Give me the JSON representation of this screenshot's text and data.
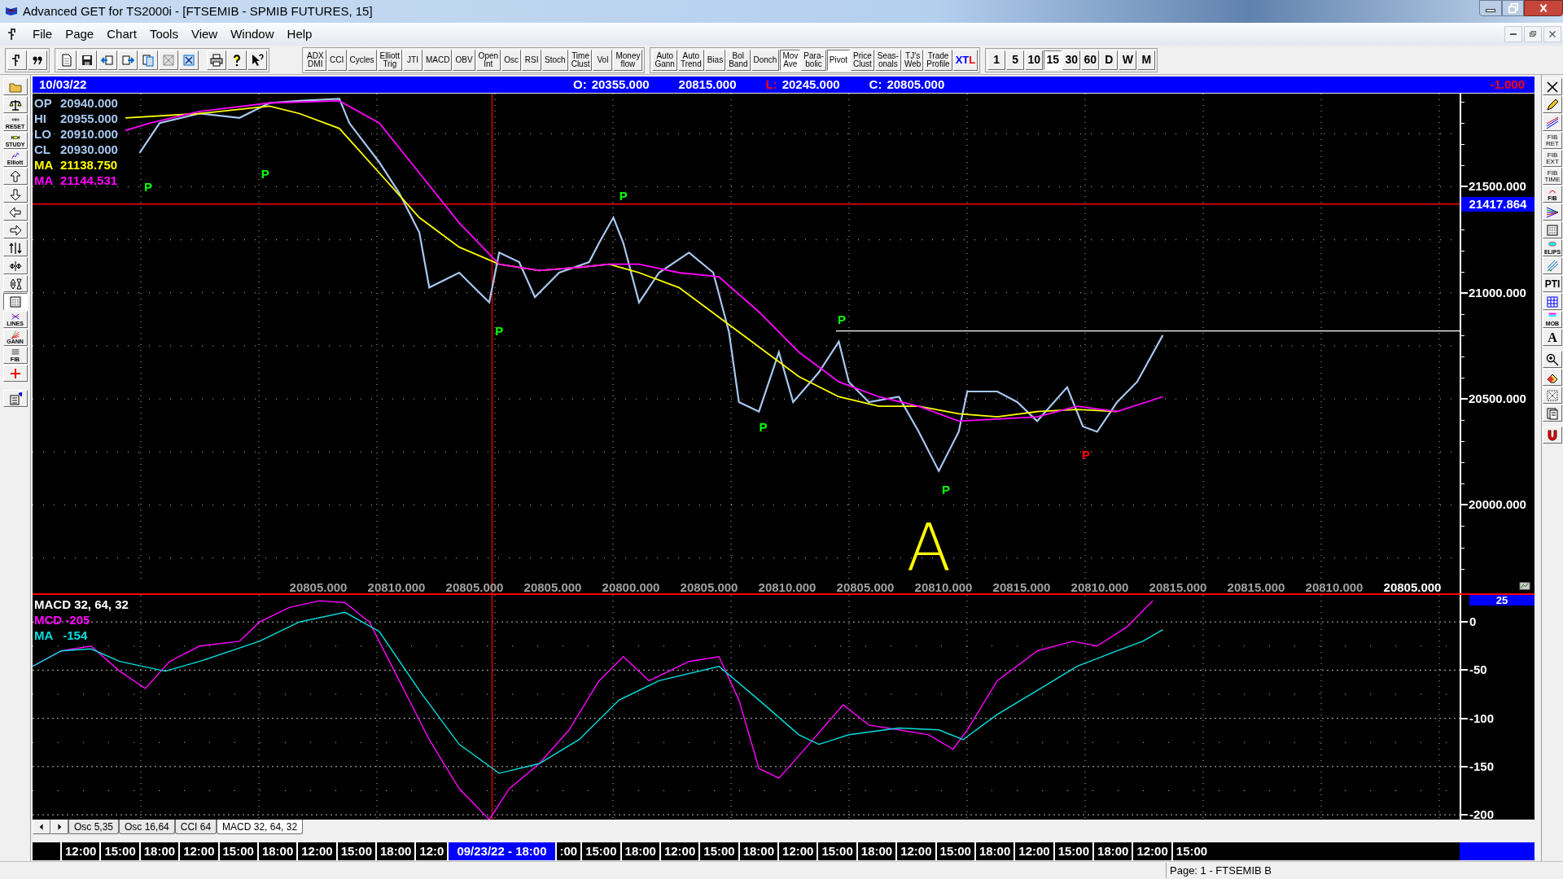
{
  "window": {
    "title": "Advanced GET for TS2000i - [FTSEMIB - SPMIB FUTURES, 15]"
  },
  "menu": [
    "File",
    "Page",
    "Chart",
    "Tools",
    "View",
    "Window",
    "Help"
  ],
  "toolbar": {
    "indicators": [
      {
        "label": "ADX\nDMI",
        "pressed": false
      },
      {
        "label": "CCI",
        "pressed": false
      },
      {
        "label": "Cycles",
        "pressed": false
      },
      {
        "label": "Elliott\nTrig",
        "pressed": false
      },
      {
        "label": "JTI",
        "pressed": false
      },
      {
        "label": "MACD",
        "pressed": false
      },
      {
        "label": "OBV",
        "pressed": false
      },
      {
        "label": "Open\nInt",
        "pressed": false
      },
      {
        "label": "Osc",
        "pressed": false
      },
      {
        "label": "RSI",
        "pressed": false
      },
      {
        "label": "Stoch",
        "pressed": false
      },
      {
        "label": "Time\nClust",
        "pressed": false
      },
      {
        "label": "Vol",
        "pressed": false
      },
      {
        "label": "Money\nflow",
        "pressed": false
      }
    ],
    "studies": [
      {
        "kind": "plain",
        "label": "Auto\nGann",
        "pressed": false
      },
      {
        "kind": "plain",
        "label": "Auto\nTrend",
        "pressed": false
      },
      {
        "kind": "plain",
        "label": "Bias",
        "pressed": false
      },
      {
        "kind": "plain",
        "label": "Bol\nBand",
        "pressed": false
      },
      {
        "kind": "plain",
        "label": "Donch",
        "pressed": false
      },
      {
        "kind": "plain",
        "label": "Mov\nAve",
        "pressed": true
      },
      {
        "kind": "plain",
        "label": "Para-\nbolic",
        "pressed": false
      },
      {
        "kind": "plain",
        "label": "Pivot",
        "pressed": true
      },
      {
        "kind": "plain",
        "label": "Price\nClust",
        "pressed": false
      },
      {
        "kind": "plain",
        "label": "Seas-\nonals",
        "pressed": false
      },
      {
        "kind": "plain",
        "label": "TJ's\nWeb",
        "pressed": false
      },
      {
        "kind": "plain",
        "label": "Trade\nProfile",
        "pressed": false
      },
      {
        "kind": "colored",
        "parts": [
          {
            "text": "X",
            "color": "#0000ff"
          },
          {
            "text": "T",
            "color": "#0000ff"
          },
          {
            "text": "L",
            "color": "#ff0000"
          }
        ],
        "pressed": false
      }
    ],
    "intervals": [
      {
        "label": "1",
        "selected": false
      },
      {
        "label": "5",
        "selected": false
      },
      {
        "label": "10",
        "selected": false
      },
      {
        "label": "15",
        "selected": true
      },
      {
        "label": "30",
        "selected": false
      },
      {
        "label": "60",
        "selected": false
      },
      {
        "label": "D",
        "selected": false
      },
      {
        "label": "W",
        "selected": false
      },
      {
        "label": "M",
        "selected": false
      }
    ]
  },
  "left_toolbar": [
    "RESET",
    "STUDY",
    "Elliott",
    "LINES",
    "GANN",
    "FIB"
  ],
  "right_toolbar": [
    "FIB\nRET",
    "FIB\nEXT",
    "FIB\nTIME",
    "FIB",
    "ELIPS",
    "PTI",
    "MOB",
    "A"
  ],
  "header": {
    "date": "10/03/22",
    "fields": [
      {
        "label": "O:",
        "color": "#ffffff",
        "value": "20355.000"
      },
      {
        "value": "20815.000"
      },
      {
        "label": "L:",
        "color": "#ff0000",
        "value": "20245.000"
      },
      {
        "label": "C:",
        "color": "#ffffff",
        "value": "20805.000"
      }
    ],
    "change": "-1.000"
  },
  "price_pane": {
    "legend": [
      {
        "label": "OP",
        "value": "20940.000",
        "color": "#a8c8f0"
      },
      {
        "label": "HI",
        "value": "20955.000",
        "color": "#a8c8f0"
      },
      {
        "label": "LO",
        "value": "20910.000",
        "color": "#a8c8f0"
      },
      {
        "label": "CL",
        "value": "20930.000",
        "color": "#a8c8f0"
      },
      {
        "label": "MA",
        "value": "21138.750",
        "color": "#ffff00"
      },
      {
        "label": "MA",
        "value": "21144.531",
        "color": "#ff00ff"
      }
    ],
    "y_labels": [
      "21500.000",
      "21000.000",
      "20500.000",
      "20000.000"
    ],
    "current_price": "21417.864",
    "markers": [
      {
        "kind": "pivot",
        "text": "P",
        "color": "#00ff00"
      },
      {
        "kind": "pivot",
        "text": "P",
        "color": "#00ff00"
      },
      {
        "kind": "pivot",
        "text": "P",
        "color": "#00ff00"
      },
      {
        "kind": "pivot",
        "text": "P",
        "color": "#00ff00"
      },
      {
        "kind": "pivot",
        "text": "P",
        "color": "#00ff00"
      },
      {
        "kind": "pivot",
        "text": "P",
        "color": "#00ff00"
      },
      {
        "kind": "pivot",
        "text": "P",
        "color": "#00ff00"
      },
      {
        "kind": "pivot",
        "text": "P",
        "color": "#ff0000"
      },
      {
        "kind": "handwritten",
        "text": "A",
        "color": "#ffff00"
      }
    ],
    "x_labels": [
      {
        "text": "20805.000",
        "highlighted": false
      },
      {
        "text": "20810.000",
        "highlighted": false
      },
      {
        "text": "20805.000",
        "highlighted": false
      },
      {
        "text": "20805.000",
        "highlighted": false
      },
      {
        "text": "20800.000",
        "highlighted": false
      },
      {
        "text": "20805.000",
        "highlighted": false
      },
      {
        "text": "20810.000",
        "highlighted": false
      },
      {
        "text": "20805.000",
        "highlighted": false
      },
      {
        "text": "20810.000",
        "highlighted": false
      },
      {
        "text": "20815.000",
        "highlighted": false
      },
      {
        "text": "20810.000",
        "highlighted": false
      },
      {
        "text": "20815.000",
        "highlighted": false
      },
      {
        "text": "20815.000",
        "highlighted": false
      },
      {
        "text": "20810.000",
        "highlighted": false
      },
      {
        "text": "20805.000",
        "highlighted": true
      }
    ]
  },
  "macd_pane": {
    "legend": [
      {
        "label": "MACD 32, 64, 32",
        "color": "#ffffff"
      },
      {
        "label": "MCD -205",
        "color": "#ff00ff"
      },
      {
        "label": "MA   -154",
        "color": "#00e0e0"
      }
    ],
    "y_labels": [
      "25",
      "0",
      "-50",
      "-100",
      "-150",
      "-200"
    ]
  },
  "tabs": [
    {
      "label": "Osc 5,35",
      "selected": false
    },
    {
      "label": "Osc 16,64",
      "selected": false
    },
    {
      "label": "CCI 64",
      "selected": false
    },
    {
      "label": "MACD 32, 64, 32",
      "selected": true
    }
  ],
  "time_axis": [
    {
      "text": "12:00",
      "highlighted": false
    },
    {
      "text": "15:00",
      "highlighted": false
    },
    {
      "text": "18:00",
      "highlighted": false
    },
    {
      "text": "12:00",
      "highlighted": false
    },
    {
      "text": "15:00",
      "highlighted": false
    },
    {
      "text": "18:00",
      "highlighted": false
    },
    {
      "text": "12:00",
      "highlighted": false
    },
    {
      "text": "15:00",
      "highlighted": false
    },
    {
      "text": "18:00",
      "highlighted": false
    },
    {
      "text": "12:0",
      "highlighted": false
    },
    {
      "text": "09/23/22 - 18:00",
      "highlighted": true
    },
    {
      "text": ":00",
      "highlighted": false
    },
    {
      "text": "15:00",
      "highlighted": false
    },
    {
      "text": "18:00",
      "highlighted": false
    },
    {
      "text": "12:00",
      "highlighted": false
    },
    {
      "text": "15:00",
      "highlighted": false
    },
    {
      "text": "18:00",
      "highlighted": false
    },
    {
      "text": "12:00",
      "highlighted": false
    },
    {
      "text": "15:00",
      "highlighted": false
    },
    {
      "text": "18:00",
      "highlighted": false
    },
    {
      "text": "12:00",
      "highlighted": false
    },
    {
      "text": "15:00",
      "highlighted": false
    },
    {
      "text": "18:00",
      "highlighted": false
    },
    {
      "text": "12:00",
      "highlighted": false
    },
    {
      "text": "15:00",
      "highlighted": false
    },
    {
      "text": "18:00",
      "highlighted": false
    },
    {
      "text": "12:00",
      "highlighted": false
    },
    {
      "text": "15:00",
      "highlighted": false
    }
  ],
  "status_bar": {
    "page": "Page: 1 - FTSEMIB B"
  }
}
